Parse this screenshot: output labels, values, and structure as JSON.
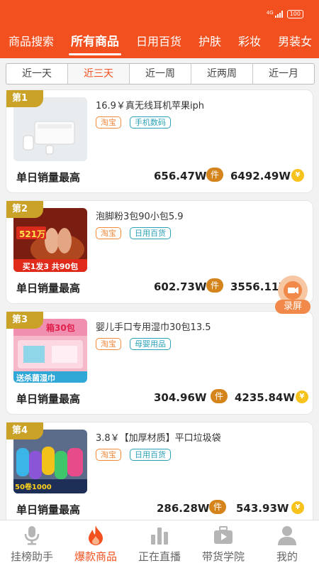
{
  "status_bar": {
    "network": "4G",
    "battery": "100"
  },
  "category_tabs": [
    "商品搜索",
    "所有商品",
    "日用百货",
    "护肤",
    "彩妆",
    "男装女"
  ],
  "active_category": "所有商品",
  "time_filters": [
    "近一天",
    "近三天",
    "近一周",
    "近两周",
    "近一月"
  ],
  "active_time_filter": "近三天",
  "products": [
    {
      "rank": "第1",
      "title": "16.9￥真无线耳机苹果iph",
      "platform": "淘宝",
      "category": "手机数码",
      "metric": "单日销量最高",
      "sales": "656.47W",
      "sales_badge": "件",
      "gmv": "6492.49W",
      "gmv_badge": "¥"
    },
    {
      "rank": "第2",
      "title": "泡脚粉3包90小包5.9",
      "platform": "淘宝",
      "category": "日用百货",
      "metric": "单日销量最高",
      "sales": "602.73W",
      "sales_badge": "件",
      "gmv": "3556.11W",
      "gmv_badge": "¥",
      "thumb_text": [
        "521万",
        "买1发3 共90包"
      ]
    },
    {
      "rank": "第3",
      "title": "婴儿手口专用湿巾30包13.5",
      "platform": "淘宝",
      "category": "母婴用品",
      "metric": "单日销量最高",
      "sales": "304.96W",
      "sales_badge": "件",
      "gmv": "4235.84W",
      "gmv_badge": "¥",
      "thumb_text": [
        "箱30包",
        "送杀菌湿巾"
      ]
    },
    {
      "rank": "第4",
      "title": "3.8￥【加厚材质】平口垃圾袋",
      "platform": "淘宝",
      "category": "日用百货",
      "metric": "单日销量最高",
      "sales": "286.28W",
      "sales_badge": "件",
      "gmv": "543.93W",
      "gmv_badge": "¥",
      "thumb_text": [
        "50卷1000"
      ]
    }
  ],
  "record_button": {
    "label": "录屏"
  },
  "bottom_nav": [
    {
      "label": "挂榜助手",
      "icon": "microphone-icon"
    },
    {
      "label": "爆款商品",
      "icon": "flame-icon"
    },
    {
      "label": "正在直播",
      "icon": "bar-chart-icon"
    },
    {
      "label": "带货学院",
      "icon": "video-briefcase-icon"
    },
    {
      "label": "我的",
      "icon": "user-icon"
    }
  ],
  "active_nav": "爆款商品",
  "colors": {
    "brand": "#f2501f",
    "rank_badge": "#c9a227",
    "tag_orange": "#f08a3c",
    "tag_blue": "#2aa1b8",
    "coin": "#f6c21b",
    "piece_badge": "#d4841a"
  }
}
